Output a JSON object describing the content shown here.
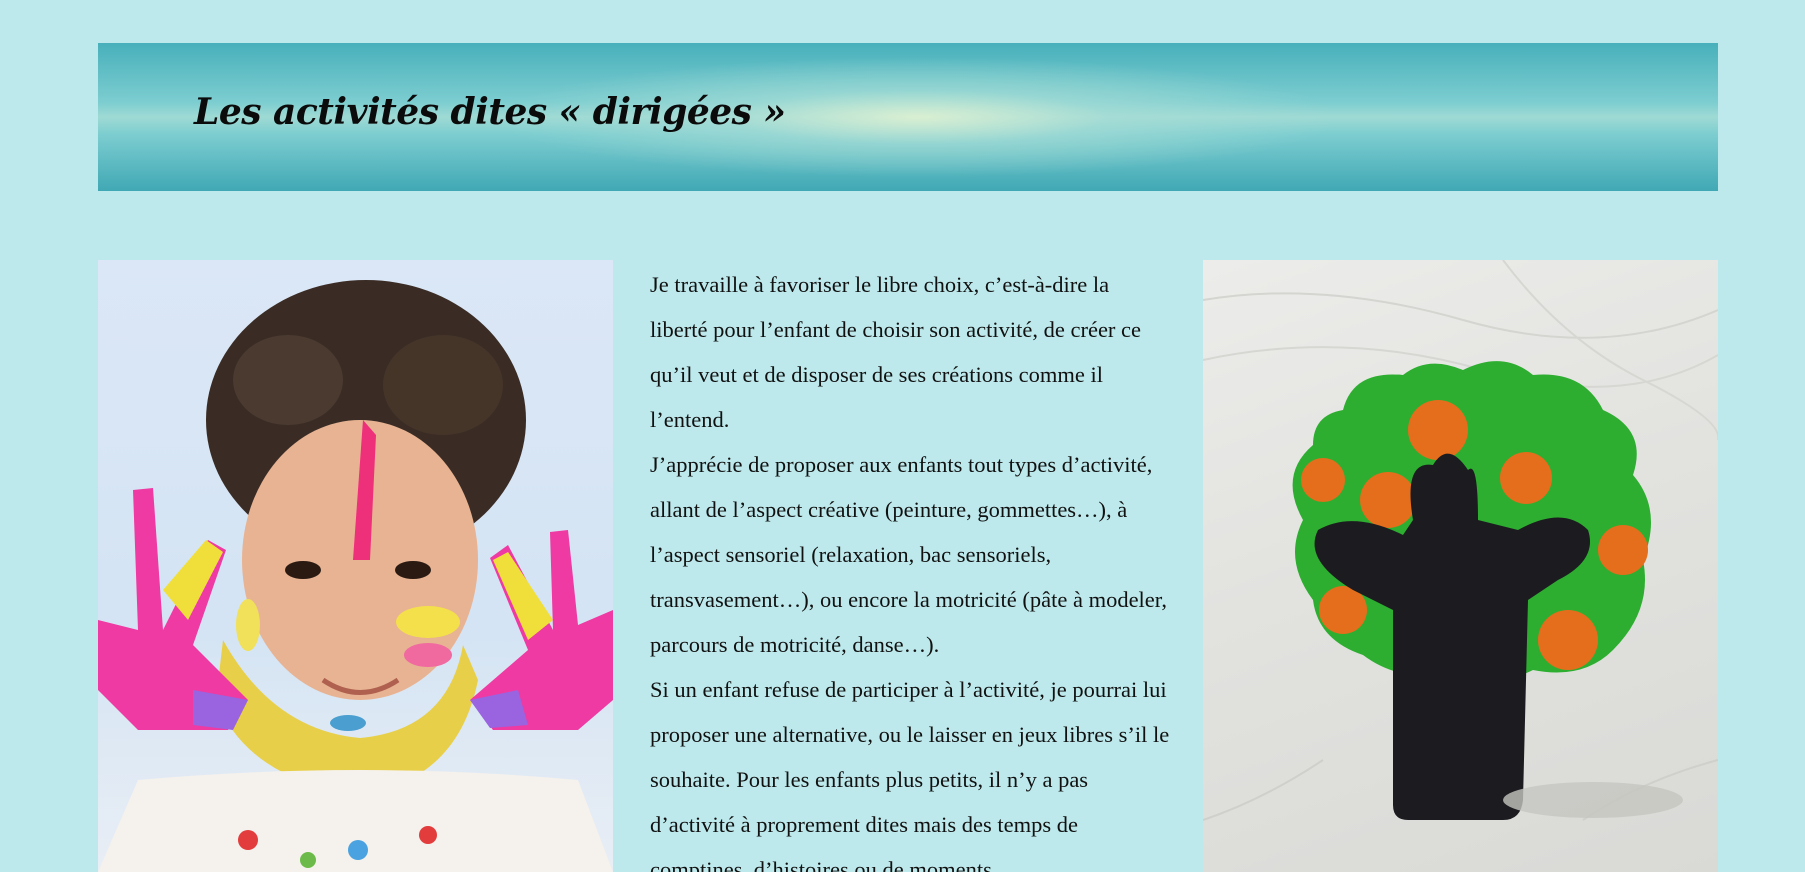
{
  "header": {
    "title": "Les activités dites « dirigées »"
  },
  "content": {
    "paragraphs": [
      "Je travaille à favoriser le libre choix, c’est-à-dire la liberté pour l’enfant de choisir son activité, de créer ce qu’il veut et de disposer de ses créations comme il l’entend.",
      "J’apprécie de proposer aux enfants tout types d’activité, allant de l’aspect créative (peinture, gommettes…), à l’aspect sensoriel (relaxation, bac sensoriels, transvasement…), ou encore la motricité (pâte à modeler, parcours de motricité, danse…).",
      "Si un enfant refuse de participer à l’activité, je pourrai lui proposer une alternative, ou le laisser en jeux libres s’il le souhaite. Pour les enfants plus petits, il n’y a pas d’activité à proprement dites mais des temps de comptines, d’histoires ou de moments"
    ]
  },
  "images": {
    "left": "child-with-painted-hands-photo",
    "right": "play-dough-tree-photo"
  },
  "colors": {
    "page_background": "#bde9ec",
    "banner_dark": "#40a8b4",
    "banner_light": "#9fdad4",
    "text": "#111111"
  }
}
